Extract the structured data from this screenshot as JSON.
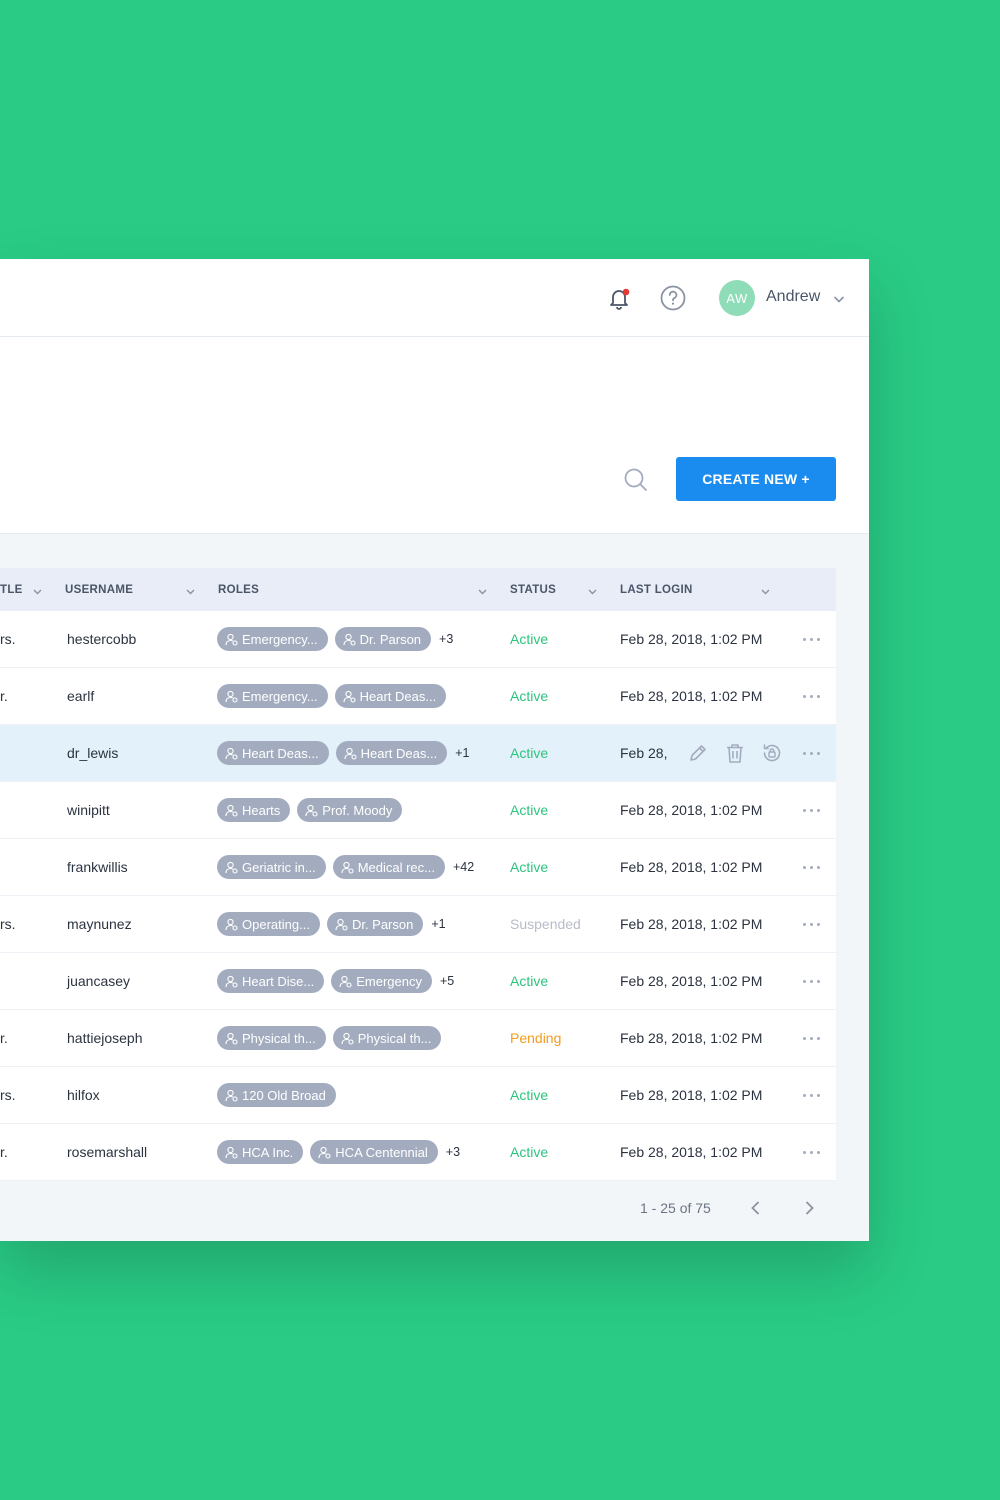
{
  "header": {
    "avatar_initials": "AW",
    "user_name": "Andrew",
    "icons": [
      "bell-icon",
      "help-icon",
      "chevron-down-icon"
    ],
    "notification_dot_color": "#e53935"
  },
  "toolbar": {
    "create_label": "CREATE NEW +",
    "accent_color": "#1a8cf0"
  },
  "table": {
    "columns": {
      "title": "TLE",
      "username": "USERNAME",
      "roles": "ROLES",
      "status": "STATUS",
      "last_login": "LAST LOGIN"
    },
    "rows": [
      {
        "title": "rs.",
        "username": "hestercobb",
        "roles": [
          "Emergency...",
          "Dr. Parson"
        ],
        "more": "+3",
        "status": "Active",
        "last_login": "Feb 28, 2018, 1:02 PM"
      },
      {
        "title": "r.",
        "username": "earlf",
        "roles": [
          "Emergency...",
          "Heart Deas..."
        ],
        "more": "",
        "status": "Active",
        "last_login": "Feb 28, 2018, 1:02 PM"
      },
      {
        "title": "",
        "username": "dr_lewis",
        "roles": [
          "Heart Deas...",
          "Heart Deas..."
        ],
        "more": "+1",
        "status": "Active",
        "last_login": "Feb 28,"
      },
      {
        "title": "",
        "username": "winipitt",
        "roles": [
          "Hearts",
          "Prof. Moody"
        ],
        "more": "",
        "status": "Active",
        "last_login": "Feb 28, 2018, 1:02 PM"
      },
      {
        "title": "",
        "username": "frankwillis",
        "roles": [
          "Geriatric in...",
          "Medical rec..."
        ],
        "more": "+42",
        "status": "Active",
        "last_login": "Feb 28, 2018, 1:02 PM"
      },
      {
        "title": "rs.",
        "username": "maynunez",
        "roles": [
          "Operating...",
          "Dr. Parson"
        ],
        "more": "+1",
        "status": "Suspended",
        "last_login": "Feb 28, 2018, 1:02 PM"
      },
      {
        "title": "",
        "username": "juancasey",
        "roles": [
          "Heart Dise...",
          "Emergency"
        ],
        "more": "+5",
        "status": "Active",
        "last_login": "Feb 28, 2018, 1:02 PM"
      },
      {
        "title": "r.",
        "username": "hattiejoseph",
        "roles": [
          "Physical th...",
          "Physical th..."
        ],
        "more": "",
        "status": "Pending",
        "last_login": "Feb 28, 2018, 1:02 PM"
      },
      {
        "title": "rs.",
        "username": "hilfox",
        "roles": [
          "120 Old Broad"
        ],
        "more": "",
        "status": "Active",
        "last_login": "Feb 28, 2018, 1:02 PM"
      },
      {
        "title": "r.",
        "username": "rosemarshall",
        "roles": [
          "HCA Inc.",
          "HCA Centennial"
        ],
        "more": "+3",
        "status": "Active",
        "last_login": "Feb 28, 2018, 1:02 PM"
      }
    ],
    "highlighted_row": 2,
    "status_colors": {
      "Active": "#2cc57e",
      "Suspended": "#b6bcc8",
      "Pending": "#f49c1c"
    }
  },
  "pagination": {
    "label": "1 - 25 of 75"
  }
}
